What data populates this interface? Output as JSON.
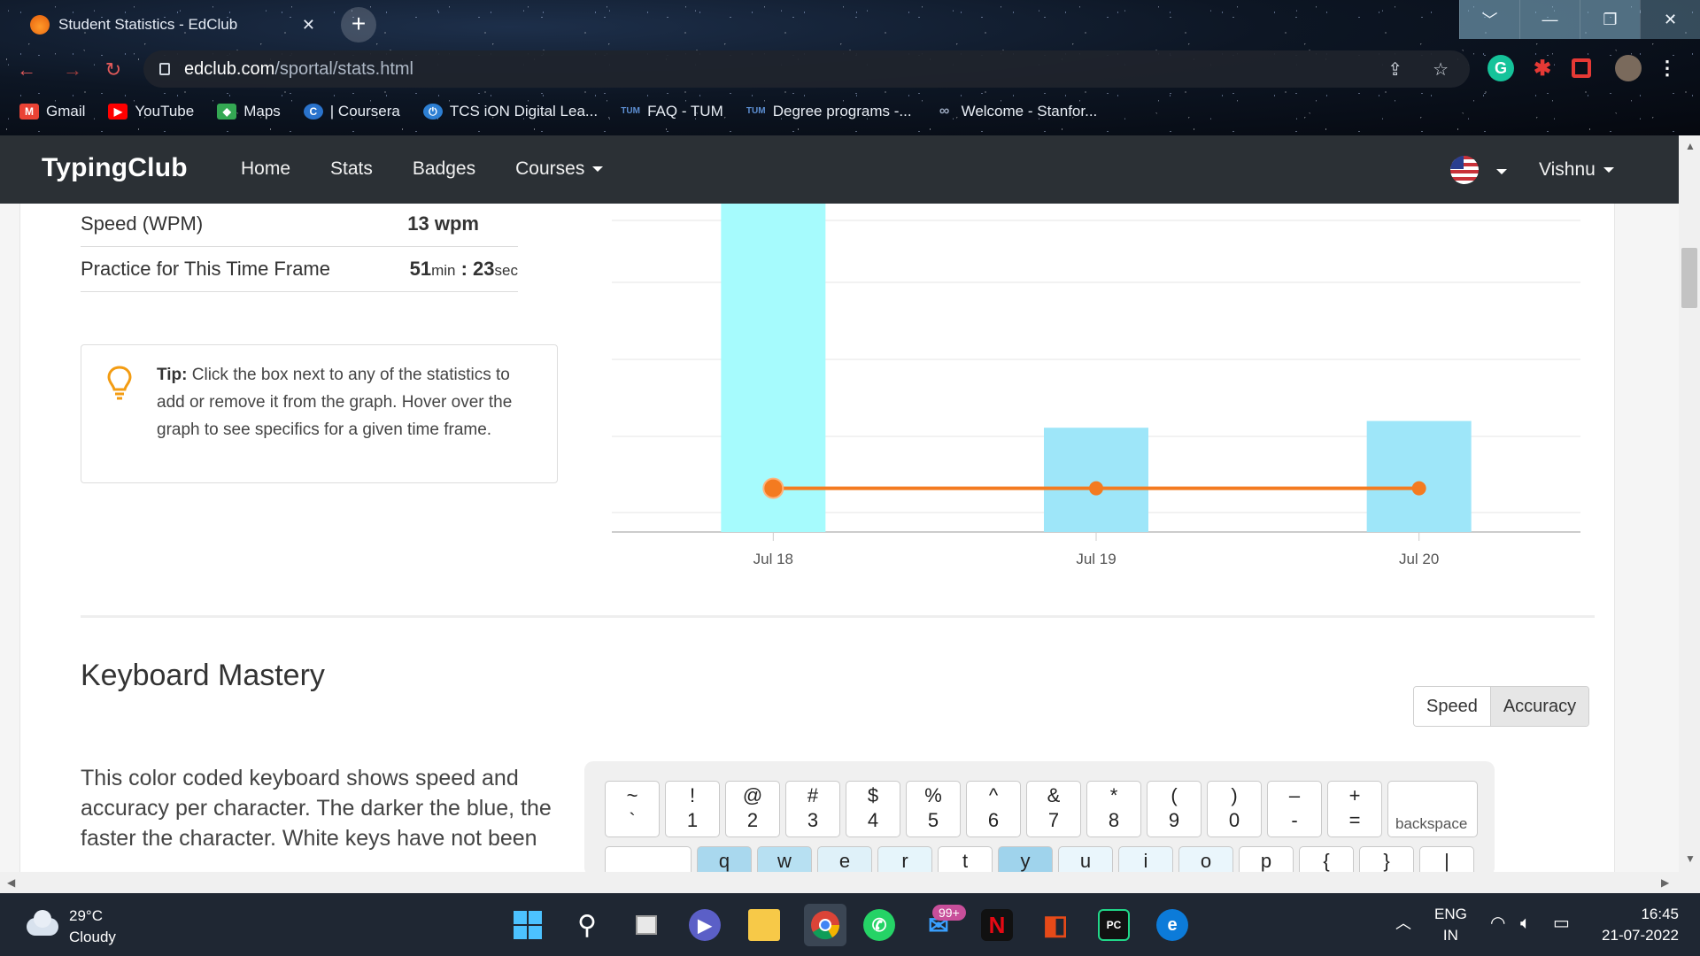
{
  "browser": {
    "tab_title": "Student Statistics - EdClub",
    "close_glyph": "✕",
    "new_tab_glyph": "+",
    "url_host": "edclub.com",
    "url_path": "/sportal/stats.html",
    "window_controls": [
      "﹀",
      "—",
      "❐",
      "✕"
    ],
    "bookmarks": [
      {
        "label": "Gmail",
        "icon": "gmail-icon",
        "color": "#ea4335",
        "glyph": "M"
      },
      {
        "label": "YouTube",
        "icon": "youtube-icon",
        "color": "#ff0000",
        "glyph": "▶"
      },
      {
        "label": "Maps",
        "icon": "maps-icon",
        "color": "#34a853",
        "glyph": "◆"
      },
      {
        "label": "| Coursera",
        "icon": "coursera-icon",
        "color": "#2a73cc",
        "glyph": "C"
      },
      {
        "label": "TCS iON Digital Lea...",
        "icon": "tcs-icon",
        "color": "#2d7fd3",
        "glyph": "⏻"
      },
      {
        "label": "FAQ - TUM",
        "icon": "tum-icon",
        "color": "#3070b3",
        "glyph": "TUM"
      },
      {
        "label": "Degree programs -...",
        "icon": "tum-icon",
        "color": "#3070b3",
        "glyph": "TUM"
      },
      {
        "label": "Welcome - Stanfor...",
        "icon": "link-icon",
        "color": "#9aa7bd",
        "glyph": "∞"
      }
    ]
  },
  "site": {
    "logo": "TypingClub",
    "nav": [
      "Home",
      "Stats",
      "Badges",
      "Courses"
    ],
    "user": "Vishnu"
  },
  "stats": {
    "speed_label": "Speed (WPM)",
    "speed_value": "13 wpm",
    "practice_label": "Practice for This Time Frame",
    "practice_min": "51",
    "practice_min_unit": "min",
    "practice_sep": " : ",
    "practice_sec": "23",
    "practice_sec_unit": "sec"
  },
  "tip": {
    "bold": "Tip:",
    "text": " Click the box next to any of the statistics to add or remove it from the graph. Hover over the graph to see specifics for a given time frame."
  },
  "chart_data": {
    "type": "bar",
    "categories": [
      "Jul 18",
      "Jul 19",
      "Jul 20"
    ],
    "series": [
      {
        "type": "bar",
        "values": [
          100,
          31,
          33
        ],
        "colors": [
          "#a6fbfd",
          "#9ee6f9",
          "#9ee6f9"
        ]
      },
      {
        "type": "line",
        "values": [
          13,
          13,
          13
        ],
        "color": "#f47b20"
      }
    ],
    "ylim": [
      0,
      100
    ],
    "grid": true
  },
  "keyboard": {
    "title": "Keyboard Mastery",
    "toggle": [
      "Speed",
      "Accuracy"
    ],
    "description": "This color coded keyboard shows speed and accuracy per character. The darker the blue, the faster the character. White keys have not been",
    "row1": [
      {
        "top": "~",
        "bot": "`"
      },
      {
        "top": "!",
        "bot": "1"
      },
      {
        "top": "@",
        "bot": "2"
      },
      {
        "top": "#",
        "bot": "3"
      },
      {
        "top": "$",
        "bot": "4"
      },
      {
        "top": "%",
        "bot": "5"
      },
      {
        "top": "^",
        "bot": "6"
      },
      {
        "top": "&",
        "bot": "7"
      },
      {
        "top": "*",
        "bot": "8"
      },
      {
        "top": "(",
        "bot": "9"
      },
      {
        "top": ")",
        "bot": "0"
      },
      {
        "top": "–",
        "bot": "-"
      },
      {
        "top": "+",
        "bot": "="
      }
    ],
    "backspace": "backspace",
    "row2_glyphs": [
      "",
      "q",
      "w",
      "e",
      "r",
      "t",
      "y",
      "u",
      "i",
      "o",
      "p",
      "{",
      "}",
      "|"
    ]
  },
  "taskbar": {
    "temp": "29°C",
    "condition": "Cloudy",
    "mail_badge": "99+",
    "lang1": "ENG",
    "lang2": "IN",
    "time": "16:45",
    "date": "21-07-2022"
  }
}
